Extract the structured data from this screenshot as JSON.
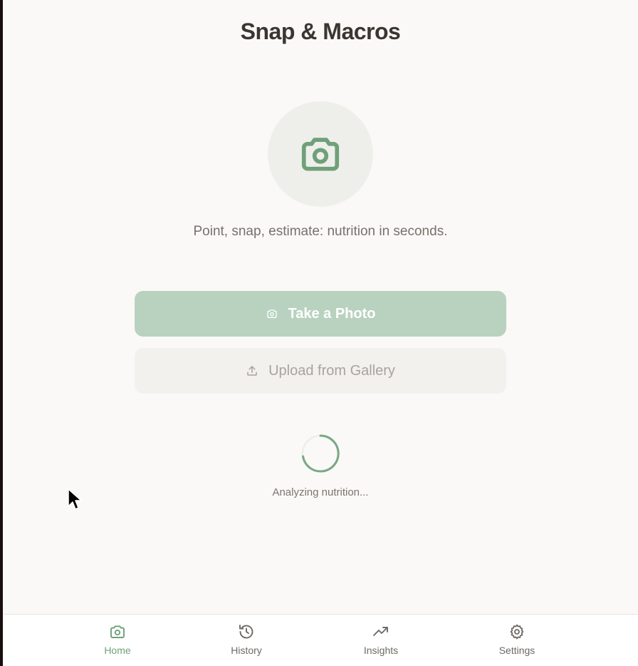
{
  "header": {
    "title": "Snap & Macros"
  },
  "hero": {
    "icon": "camera-icon",
    "tagline": "Point, snap, estimate: nutrition in seconds."
  },
  "actions": {
    "take_photo_label": "Take a Photo",
    "take_photo_icon": "camera-icon",
    "upload_label": "Upload from Gallery",
    "upload_icon": "upload-icon"
  },
  "status": {
    "loading_text": "Analyzing nutrition..."
  },
  "tabbar": {
    "items": [
      {
        "label": "Home",
        "icon": "camera-icon",
        "active": true
      },
      {
        "label": "History",
        "icon": "history-icon",
        "active": false
      },
      {
        "label": "Insights",
        "icon": "trend-up-icon",
        "active": false
      },
      {
        "label": "Settings",
        "icon": "gear-icon",
        "active": false
      }
    ]
  },
  "colors": {
    "accent": "#6fa07a",
    "primary_button": "#b9d2bf",
    "secondary_button": "#f2f1ed",
    "background": "#faf9f7"
  }
}
